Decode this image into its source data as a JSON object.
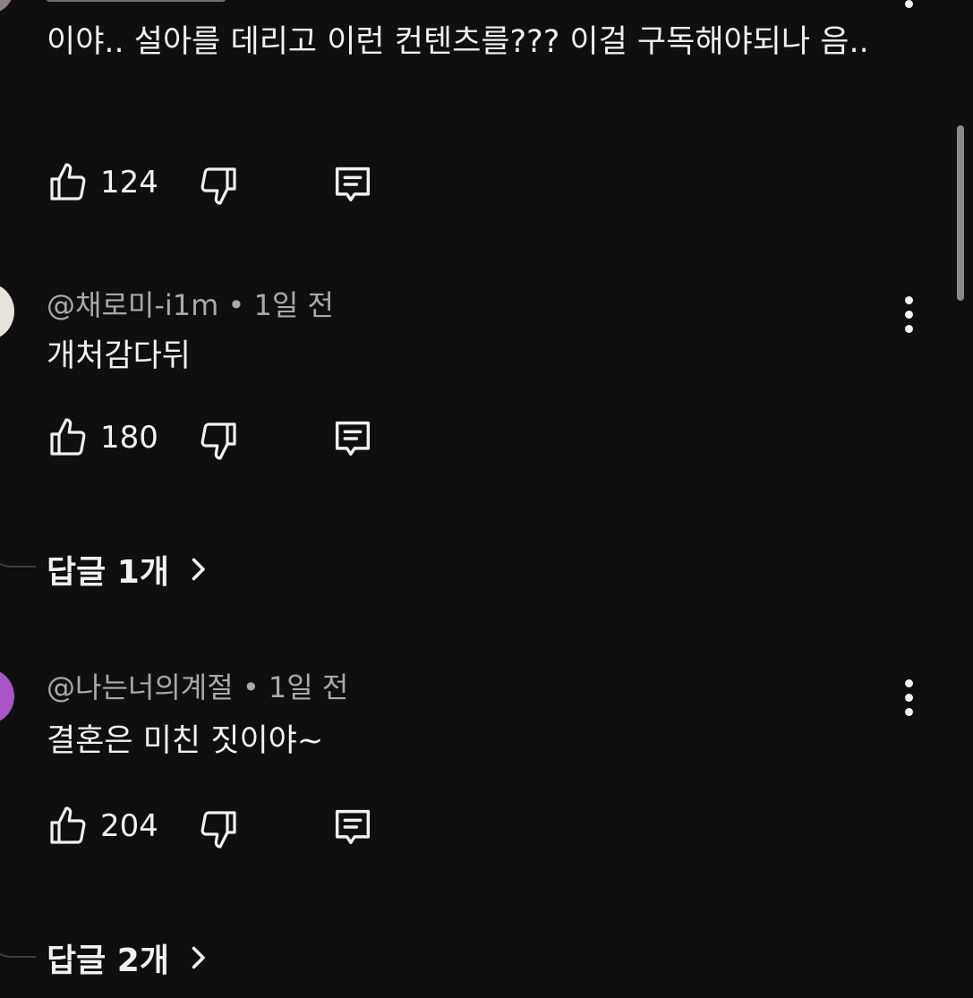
{
  "comments": [
    {
      "text": "이야.. 설아를 데리고 이런 컨텐츠를??? 이걸 구독해야되나 음..",
      "likes": "124"
    },
    {
      "author": "@채로미-i1m",
      "time": "1일 전",
      "text": "개처감다뒤",
      "likes": "180",
      "replies_label": "답글 1개"
    },
    {
      "author": "@나는너의계절",
      "time": "1일 전",
      "text": "결혼은 미친 짓이야~",
      "likes": "204",
      "replies_label": "답글 2개",
      "avatar_color": "#a855c8"
    }
  ],
  "icons": {
    "like": "thumbs-up-icon",
    "dislike": "thumbs-down-icon",
    "reply": "reply-icon",
    "menu": "more-vert-icon",
    "chevron": "chevron-right-icon"
  },
  "colors": {
    "background": "#0f0f0f",
    "text": "#f1f1f1",
    "meta_text": "#aaaaaa"
  }
}
